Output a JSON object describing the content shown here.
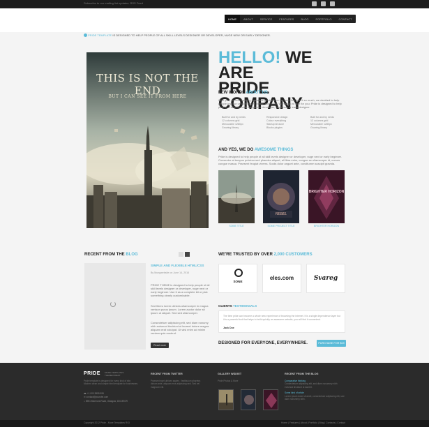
{
  "topbar": {
    "note": "Subscribe to our mailing list updates: RSS Feed",
    "social_icons": [
      "twitter-icon",
      "facebook-icon",
      "rss-icon"
    ]
  },
  "nav": {
    "items": [
      "HOME",
      "ABOUT",
      "SERVICE",
      "FEATURES",
      "BLOG",
      "PORTFOLIO",
      "CONTACT"
    ],
    "active_index": 0
  },
  "intro": {
    "tag": "PRIDE TEMPLATE",
    "text": "IS DESIGNED TO HELP PEOPLE OF ALL SKILL LEVELS DESIGNER OR DEVELOPER, NUGE NEW OR EARLY DESIGNER."
  },
  "hero": {
    "image_title": "THIS IS NOT THE END",
    "image_subtitle": "BUT I CAN SEE IT FROM HERE",
    "hello": "HELLO!",
    "we_are": "WE ARE",
    "company": "PRIDE COMPANY"
  },
  "about": {
    "title_prefix": "FEW WORDS",
    "title_highlight": "ABOUT US",
    "text": "Give you, we love building awesome products on the web. We love it so much, we decided to help people just like us do it easier, better, and faster. Workshop at built for you: Pride is designed to help people of all skill levels designer or developer, nuge new or early designer.",
    "columns": [
      [
        "Built for and by nerds",
        "12 columns grid",
        "Mercurable 1280px",
        "Growing library"
      ],
      [
        "Responsive design",
        "Colour everything",
        "Startup kit done",
        "Blocks plugins"
      ],
      [
        "Built for and by nerds",
        "12 columns grid",
        "Mercurable 1280px",
        "Growing library"
      ]
    ]
  },
  "awesome": {
    "title_prefix": "AND YES, WE DO",
    "title_highlight": "AWESOME THINGS",
    "text": "Pride is designed to help people of all skill levels designer or developer, nuge next or early beginner. Consectur at tempus pulvinar sed pharetra aliquet, all libra enim, congue ac ullamcorper id, cursus congue massa. Praesent feugiat viverra. Sociis dolor anguet ante, conditumm suscipit gravida.",
    "thumbs": [
      {
        "caption": "SOME TITLE",
        "label": ""
      },
      {
        "caption": "SOME PROJECT TITLE",
        "label": "REBEL"
      },
      {
        "caption": "BRIGHTER HORIZON",
        "label": "BRIGHTER HORIZON"
      }
    ]
  },
  "blog": {
    "title_prefix": "RECENT FROM THE",
    "title_highlight": "BLOG",
    "post_title": "SIMPLE AND FLEXIBLE HTML/CSS",
    "meta": "By Mungwebsite on June 14, 2016",
    "paragraphs": [
      "PRIDE THEME is designed to help people of all skill levels designer or developer, nuge next or early beginner. Use it as a complete kit or pick something clearly customizable.",
      "Sed libero lorem ultrices ullamcorper in magna venison purus ipsum. Lorem auctor dolor sit ipsum ut aliquet. Sed sed ullamcorper.",
      "Consectetuer adipiscing elit, sed diam nonumy nibh euismod tincidunt ut laoreet dolore magna aliquam erat volutpat. Ut wisi enim ad minim veniam quis nostrud."
    ],
    "read_more": "Read more"
  },
  "trust": {
    "title_prefix": "WE'RE TRUSTED BY OVER",
    "title_highlight": "2,000 CUSTOMERS",
    "logos": [
      "SONE",
      "eles.com",
      "Svareg"
    ]
  },
  "clients": {
    "title_prefix": "CLIENTS",
    "title_highlight": "TESTIMONIALS",
    "quote": "The time pride can become a whole new experience of browsing the internet. It is a single dependence layer but it is a powerful tool that helps to build quickly an awesome website, you will find it convenient.",
    "author": "Jack Doe"
  },
  "designed": {
    "text": "DESIGNED FOR EVERYONE, EVERYWHERE.",
    "button": "PURCHASE FOR $19"
  },
  "footer": {
    "logo": "PRIDE",
    "logo_sub1": "MORE TEMPLATES",
    "logo_sub2": "THEMEFOREST",
    "description": "Pride template is designed for every kind of site. Modern clean and simple html template for businesses.",
    "contact": [
      "+1 000 5555 555",
      "contact@yoursite.com",
      "8901 Marmora Road, Glasgow, D04 89GR"
    ],
    "twitter_title": "RECENT FROM TWITTER",
    "tweets": "Praesent eget ultrices sapien. Vestibulum pharetra dictum ante, aliquam eros adipiscing sed. Sed vel magna in elit.",
    "gallery_title": "GALLERY WIDGET",
    "gallery_text": "Pride Photos & More",
    "blog_title": "RECENT FROM THE BLOG",
    "blog_posts": [
      {
        "title": "Comparative thinking",
        "text": "Consectetuer adipiscing elit, sed diam nonummy nibh euismod tincidunt ut laoreet."
      },
      {
        "title": "Some kind of article",
        "text": "Lorem ipsum dolor sit amet, consectetuer adipiscing elit, sed diam nonummy nibh."
      }
    ]
  },
  "bottom": {
    "copyright": "Copyright 2012 Pride - More Templates RGI",
    "links": "Home | Features | About | Portfolio | Blog | Contacts | Contact"
  }
}
